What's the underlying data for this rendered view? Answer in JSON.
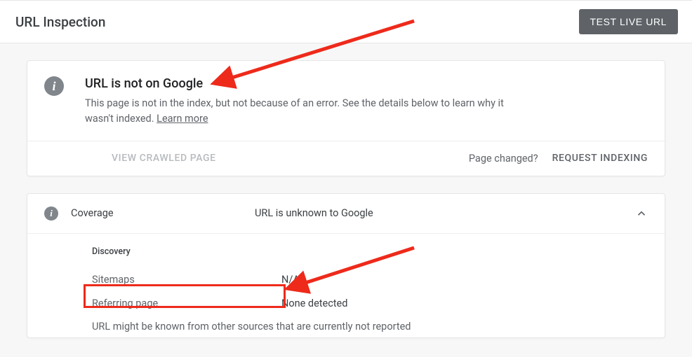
{
  "header": {
    "title": "URL Inspection",
    "test_button": "TEST LIVE URL"
  },
  "status_card": {
    "title": "URL is not on Google",
    "description_part1": "This page is not in the index, but not because of an error. See the details below to learn why it wasn't indexed. ",
    "learn_more": "Learn more",
    "view_crawled": "VIEW CRAWLED PAGE",
    "page_changed": "Page changed?",
    "request_indexing": "REQUEST INDEXING"
  },
  "coverage": {
    "label": "Coverage",
    "status": "URL is unknown to Google",
    "discovery_heading": "Discovery",
    "rows": [
      {
        "key": "Sitemaps",
        "val": "N/A"
      },
      {
        "key": "Referring page",
        "val": "None detected"
      }
    ],
    "note": "URL might be known from other sources that are currently not reported"
  }
}
